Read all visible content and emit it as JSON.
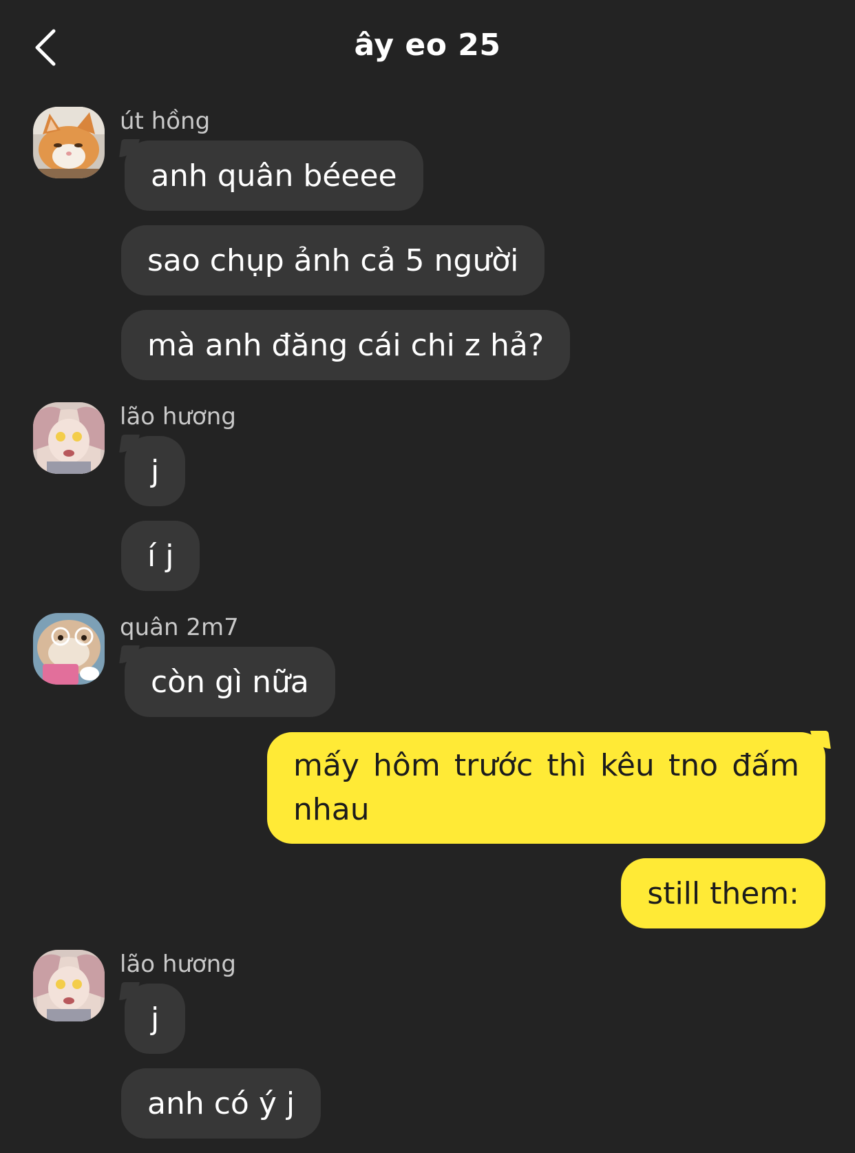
{
  "header": {
    "title": "ây eo 25"
  },
  "colors": {
    "background": "#232323",
    "incoming_bubble": "#373737",
    "outgoing_bubble": "#ffea36"
  },
  "messages": [
    {
      "sender": "út hồng",
      "avatar": "orange-cat-avatar",
      "text": "anh quân béeee"
    },
    {
      "text": "sao chụp ảnh cả 5 người"
    },
    {
      "text": "mà anh đăng cái chi z hả?"
    },
    {
      "sender": "lão hương",
      "avatar": "anime-girl-avatar",
      "text": "j"
    },
    {
      "text": "í j"
    },
    {
      "sender": "quân 2m7",
      "avatar": "hamster-glasses-avatar",
      "text": "còn gì nữa"
    },
    {
      "outgoing": true,
      "text": "mấy hôm trước thì kêu tno đấm nhau"
    },
    {
      "outgoing": true,
      "text": "still them:"
    },
    {
      "sender": "lão hương",
      "avatar": "anime-girl-avatar",
      "text": "j"
    },
    {
      "text": "anh có ý j"
    }
  ]
}
